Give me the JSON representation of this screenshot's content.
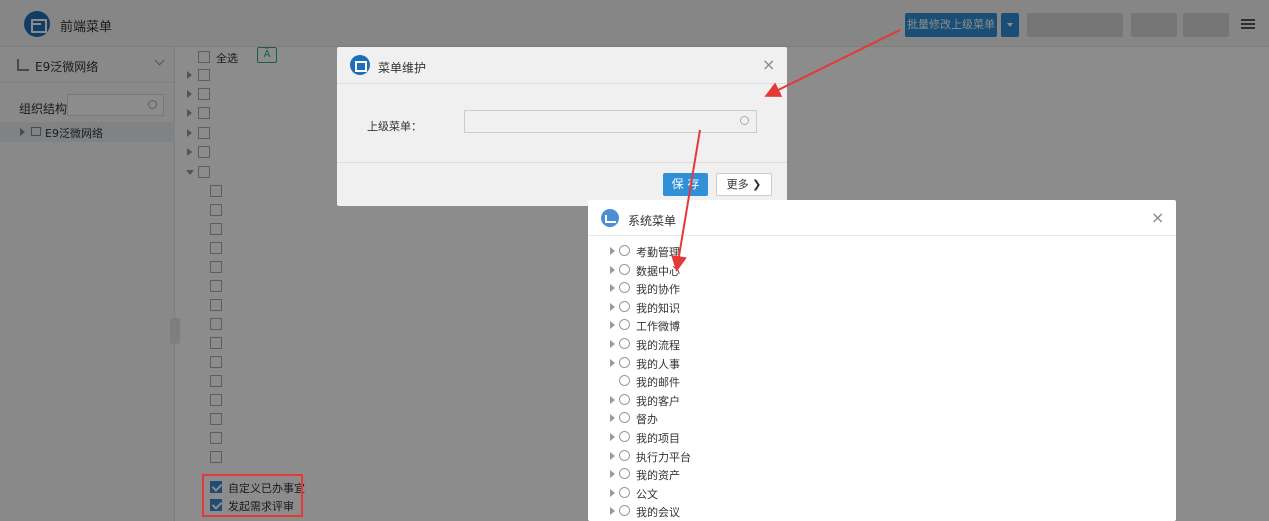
{
  "header": {
    "title": "前端菜单",
    "buttons": [
      "批量修改上级菜单"
    ],
    "accent": "#2f8fd8"
  },
  "sidebar": {
    "org_name": "E9泛微网络",
    "structure_label": "组织结构",
    "tree_root": "E9泛微网络"
  },
  "menu_list": {
    "select_all": "全选",
    "collapse_glyph": "Ā",
    "custom_items": [
      "自定义已办事宜",
      "发起需求评审"
    ]
  },
  "dialog_menu": {
    "title": "菜单维护",
    "field_label": "上级菜单：",
    "save_label": "保 存",
    "more_label": "更多 ❯"
  },
  "dialog_system": {
    "title": "系统菜单",
    "items": [
      {
        "label": "考勤管理",
        "expandable": true
      },
      {
        "label": "数据中心",
        "expandable": true
      },
      {
        "label": "我的协作",
        "expandable": true
      },
      {
        "label": "我的知识",
        "expandable": true
      },
      {
        "label": "工作微博",
        "expandable": true
      },
      {
        "label": "我的流程",
        "expandable": true
      },
      {
        "label": "我的人事",
        "expandable": true
      },
      {
        "label": "我的邮件",
        "expandable": false
      },
      {
        "label": "我的客户",
        "expandable": true
      },
      {
        "label": "督办",
        "expandable": true
      },
      {
        "label": "我的项目",
        "expandable": true
      },
      {
        "label": "执行力平台",
        "expandable": true
      },
      {
        "label": "我的资产",
        "expandable": true
      },
      {
        "label": "公文",
        "expandable": true
      },
      {
        "label": "我的会议",
        "expandable": true
      }
    ]
  },
  "annotation_color": "#e53935"
}
